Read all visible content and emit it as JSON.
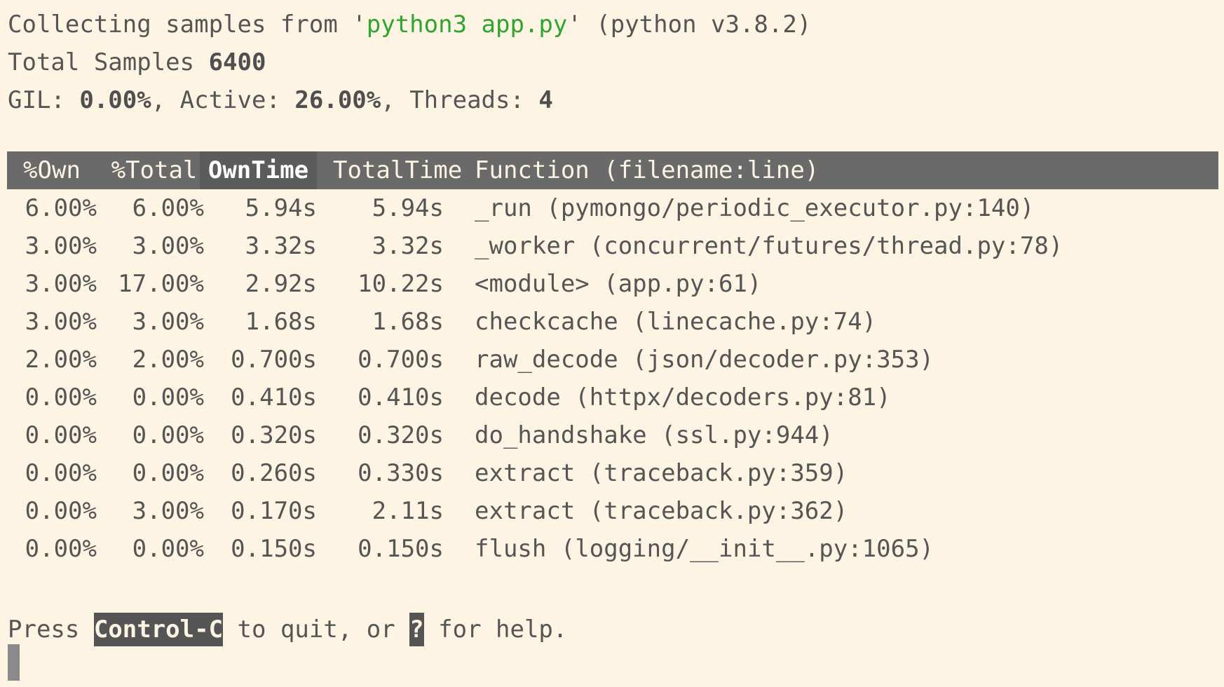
{
  "header": {
    "collecting_prefix": "Collecting samples from '",
    "command": "python3 app.py",
    "collecting_suffix": "' (python v3.8.2)",
    "total_samples_label": "Total Samples ",
    "total_samples_value": "6400",
    "gil_label": "GIL: ",
    "gil_value": "0.00%",
    "active_label": ", Active: ",
    "active_value": "26.00%",
    "threads_label": ", Threads: ",
    "threads_value": "4"
  },
  "table": {
    "columns": {
      "own": "%Own",
      "total": "%Total",
      "own_time": "OwnTime",
      "total_time": "TotalTime",
      "function": "Function (filename:line)"
    },
    "sorted_column": "OwnTime",
    "rows": [
      {
        "own": "6.00%",
        "total": "6.00%",
        "own_time": "5.94s",
        "total_time": "5.94s",
        "function": "_run (pymongo/periodic_executor.py:140)"
      },
      {
        "own": "3.00%",
        "total": "3.00%",
        "own_time": "3.32s",
        "total_time": "3.32s",
        "function": "_worker (concurrent/futures/thread.py:78)"
      },
      {
        "own": "3.00%",
        "total": "17.00%",
        "own_time": "2.92s",
        "total_time": "10.22s",
        "function": "<module> (app.py:61)"
      },
      {
        "own": "3.00%",
        "total": "3.00%",
        "own_time": "1.68s",
        "total_time": "1.68s",
        "function": "checkcache (linecache.py:74)"
      },
      {
        "own": "2.00%",
        "total": "2.00%",
        "own_time": "0.700s",
        "total_time": "0.700s",
        "function": "raw_decode (json/decoder.py:353)"
      },
      {
        "own": "0.00%",
        "total": "0.00%",
        "own_time": "0.410s",
        "total_time": "0.410s",
        "function": "decode (httpx/decoders.py:81)"
      },
      {
        "own": "0.00%",
        "total": "0.00%",
        "own_time": "0.320s",
        "total_time": "0.320s",
        "function": "do_handshake (ssl.py:944)"
      },
      {
        "own": "0.00%",
        "total": "0.00%",
        "own_time": "0.260s",
        "total_time": "0.330s",
        "function": "extract (traceback.py:359)"
      },
      {
        "own": "0.00%",
        "total": "3.00%",
        "own_time": "0.170s",
        "total_time": "2.11s",
        "function": "extract (traceback.py:362)"
      },
      {
        "own": "0.00%",
        "total": "0.00%",
        "own_time": "0.150s",
        "total_time": "0.150s",
        "function": "flush (logging/__init__.py:1065)"
      }
    ]
  },
  "footer": {
    "press": "Press ",
    "quit_key": "Control-C",
    "quit_text": " to quit, or ",
    "help_key": "?",
    "help_text": " for help."
  },
  "colors": {
    "background": "#fdf4e3",
    "text": "#555555",
    "command": "#2fa52f",
    "header_bar": "#6a6a6a"
  }
}
